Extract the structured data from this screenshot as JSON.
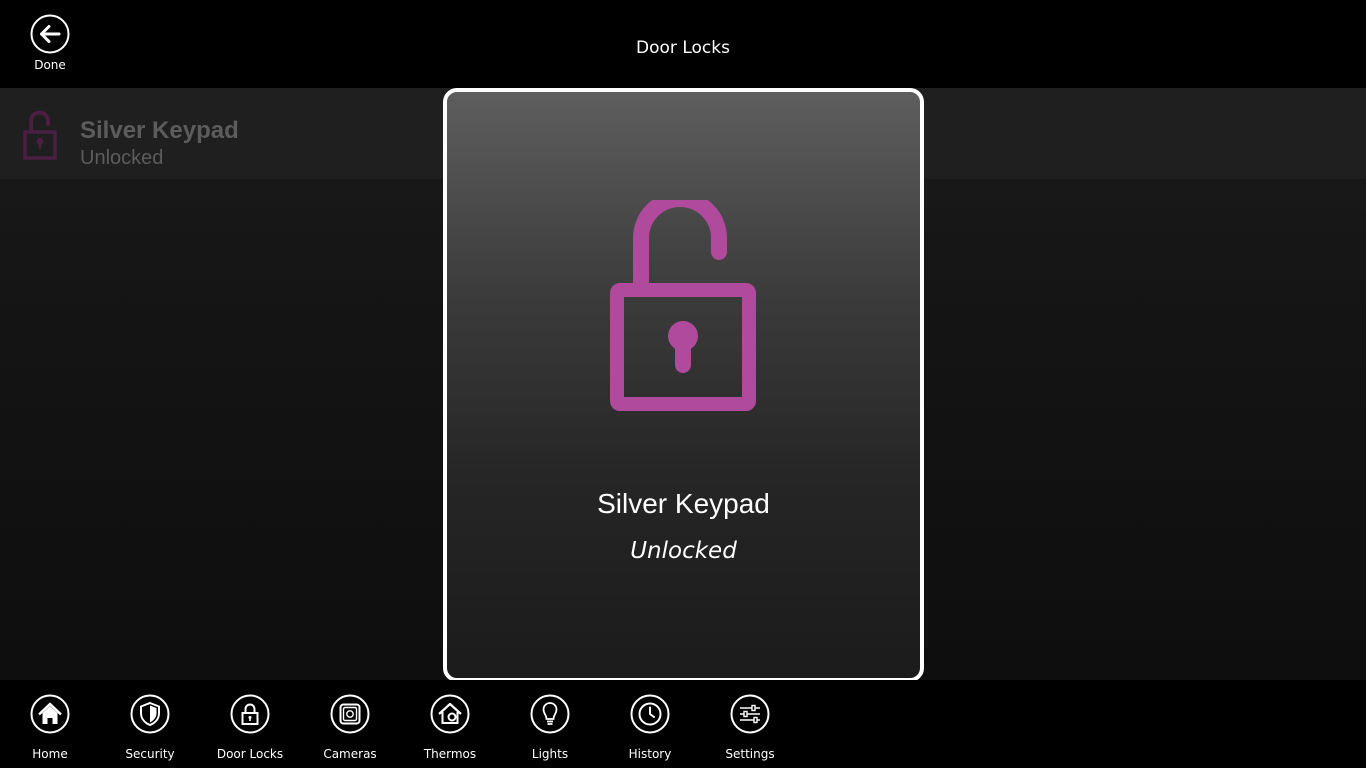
{
  "header": {
    "done_label": "Done",
    "title": "Door Locks"
  },
  "lock_list": [
    {
      "name": "Silver Keypad",
      "status": "Unlocked"
    }
  ],
  "modal": {
    "name": "Silver Keypad",
    "status": "Unlocked"
  },
  "nav": [
    {
      "label": "Home",
      "icon": "home-icon"
    },
    {
      "label": "Security",
      "icon": "shield-icon"
    },
    {
      "label": "Door Locks",
      "icon": "lock-icon"
    },
    {
      "label": "Cameras",
      "icon": "camera-icon"
    },
    {
      "label": "Thermos",
      "icon": "thermostat-icon"
    },
    {
      "label": "Lights",
      "icon": "lightbulb-icon"
    },
    {
      "label": "History",
      "icon": "clock-icon"
    },
    {
      "label": "Settings",
      "icon": "sliders-icon"
    }
  ],
  "colors": {
    "accent": "#b04a9c",
    "accent_dim": "#4a1f42",
    "background": "#000000"
  }
}
